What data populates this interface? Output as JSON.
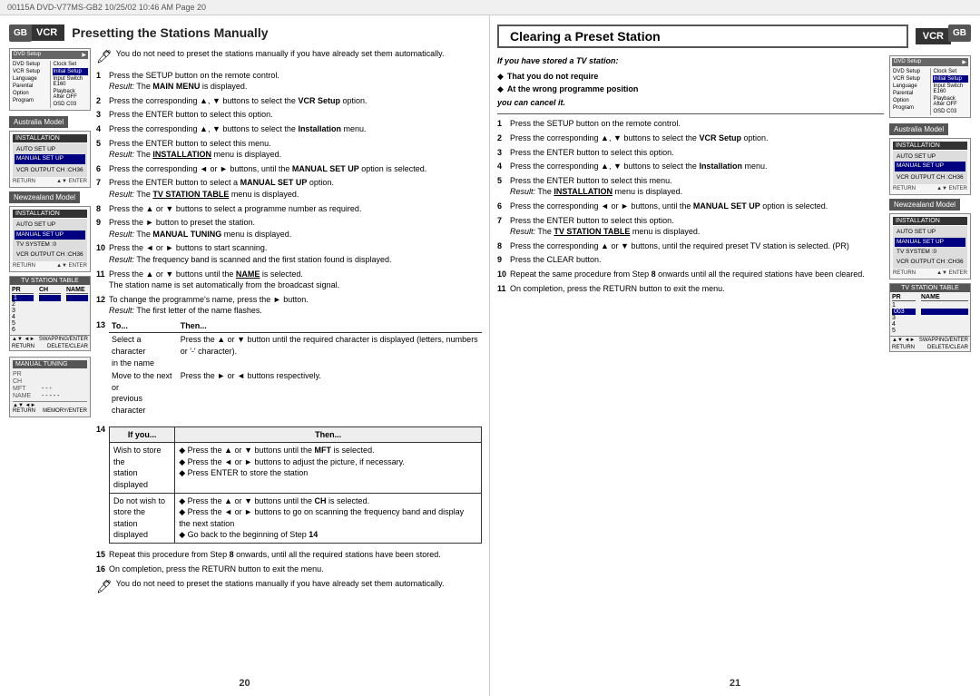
{
  "header": {
    "text": "00115A  DVD-V77MS-GB2   10/25/02  10:46 AM   Page 20"
  },
  "leftPage": {
    "vcr_badge": "VCR",
    "title": "Presetting the Stations Manually",
    "gb_badge": "GB",
    "note1": "You do not need to preset the stations manually if you have already set them automatically.",
    "steps": [
      {
        "num": "1",
        "text": "Press the SETUP button on the remote control.",
        "result": "The MAIN MENU is displayed.",
        "result_label": "Result:"
      },
      {
        "num": "2",
        "text": "Press the corresponding ▲, ▼ buttons to select the VCR Setup option.",
        "result": "",
        "result_label": ""
      },
      {
        "num": "3",
        "text": "Press the ENTER button to select this option.",
        "result": "",
        "result_label": ""
      },
      {
        "num": "4",
        "text": "Press the corresponding ▲, ▼ buttons to select the Installation menu.",
        "result": "",
        "result_label": ""
      },
      {
        "num": "5",
        "text": "Press the ENTER button to select this menu.",
        "result": "The INSTALLATION menu is displayed.",
        "result_label": "Result:"
      },
      {
        "num": "6",
        "text": "Press the corresponding ◄ or ► buttons, until the MANUAL SET UP option is selected.",
        "result": "",
        "result_label": ""
      },
      {
        "num": "7",
        "text": "Press the ENTER button to select a MANUAL SET UP option.",
        "result": "The TV STATION TABLE menu is displayed.",
        "result_label": "Result:"
      },
      {
        "num": "8",
        "text": "Press the ▲ or ▼ buttons to select a programme number as required.",
        "result": "",
        "result_label": ""
      },
      {
        "num": "9",
        "text": "Press the ► button to preset the station.",
        "result": "The MANUAL TUNING menu is displayed.",
        "result_label": "Result:"
      },
      {
        "num": "10",
        "text": "Press the ◄ or ► buttons to start scanning.",
        "result": "The frequency band is scanned and the first station found is displayed.",
        "result_label": "Result:"
      },
      {
        "num": "11",
        "text": "Press the ▲ or ▼ buttons until the NAME is selected.",
        "result": "The station name is set automatically from the broadcast signal.",
        "result_label": ""
      },
      {
        "num": "12",
        "text": "To change the programme's name, press the ► button.",
        "result": "The first letter of the name flashes.",
        "result_label": "Result:"
      },
      {
        "num": "13",
        "text": "To...",
        "then": "Then..."
      },
      {
        "num": "14",
        "text": "If you...",
        "then": "Then..."
      },
      {
        "num": "15",
        "text": "Repeat this procedure from Step 8 onwards, until all the required stations have been stored.",
        "result": "",
        "result_label": ""
      },
      {
        "num": "16",
        "text": "On completion, press the RETURN button to exit the menu.",
        "result": "",
        "result_label": ""
      }
    ],
    "step13_rows": [
      {
        "action": "Select a character in the name",
        "instruction": "Press the ▲ or ▼ button until the required character is displayed (letters, numbers or '-' character)."
      },
      {
        "action": "Move to the next or previous character",
        "instruction": "Press the ► or ◄ buttons respectively."
      }
    ],
    "step14_header": [
      "If you...",
      "Then..."
    ],
    "step14_rows": [
      {
        "condition": "Wish to store the station displayed",
        "instructions": [
          "Press the ▲ or ▼ buttons until the MFT is selected.",
          "Press the ◄ or ► buttons to adjust the picture, if necessary.",
          "Press ENTER to store the station"
        ]
      },
      {
        "condition": "Do not wish to store the station displayed",
        "instructions": [
          "Press the ▲ or ▼ buttons until the CH is selected.",
          "Press the ◄ or ► buttons to go on scanning the frequency band and display the next station",
          "Go back to the beginning of Step 14"
        ]
      }
    ],
    "note2": "You do not need to preset the stations manually if you have already set them automatically.",
    "australia_label": "Australia Model",
    "newzealand_label": "Newzealand Model",
    "page_number": "20",
    "screens": {
      "top_screen": {
        "menus": [
          "DVD Setup",
          "VCR Setup",
          "Language",
          "Parental",
          "Option",
          "Program"
        ],
        "right_menus": [
          "Clock Set",
          "Initial Setup",
          "Input Switch  E160",
          "Playback After  OFF",
          "OSD  C03"
        ]
      },
      "australia_installation": {
        "title": "INSTALLATION",
        "items": [
          "AUTO SET UP",
          "MANUAL SET UP"
        ],
        "highlighted": "MANUAL SET UP",
        "sub": "VCR OUTPUT CH  :CH36",
        "bottom": [
          "RETURN",
          "▲▼ ENTER"
        ]
      },
      "newzealand_installation": {
        "title": "INSTALLATION",
        "items": [
          "AUTO SET UP",
          "MANUAL SET UP"
        ],
        "highlighted": "MANUAL SET UP",
        "sub1": "TV SYSTEM  :0",
        "sub2": "VCR OUTPUT CH  :CH36",
        "bottom": [
          "RETURN",
          "▲▼ ENTER"
        ]
      },
      "tv_station_table": {
        "title": "TV STATION TABLE",
        "cols": [
          "PR",
          "CH",
          "NAME"
        ],
        "rows": [
          "1",
          "2",
          "3",
          "4",
          "5",
          "6"
        ],
        "highlighted_row": "1",
        "bottom": [
          "▲▼ ◄►  SWAPPING/ENTER",
          "RETURN  DELETE/CLEAR"
        ]
      },
      "manual_tuning": {
        "title": "MANUAL TUNING",
        "rows": [
          {
            "label": "PR",
            "value": ""
          },
          {
            "label": "CH",
            "value": ""
          },
          {
            "label": "MFT",
            "value": "- - -"
          },
          {
            "label": "NAME",
            "value": "- - - - -"
          }
        ],
        "bottom": [
          "▲▼ ◄►",
          "RETURN  MEMORY/ENTER"
        ]
      }
    }
  },
  "rightPage": {
    "title": "Clearing a Preset Station",
    "vcr_badge": "VCR",
    "gb_badge": "GB",
    "if_stored": "If you have stored a TV station:",
    "bullets": [
      "That you do not require",
      "At the wrong programme position"
    ],
    "cancel_note": "you can cancel it.",
    "steps": [
      {
        "num": "1",
        "text": "Press the SETUP button on the remote control.",
        "result": "",
        "result_label": ""
      },
      {
        "num": "2",
        "text": "Press the corresponding ▲, ▼ buttons to select the VCR Setup option.",
        "result": "",
        "result_label": ""
      },
      {
        "num": "3",
        "text": "Press the ENTER button to select this option.",
        "result": "",
        "result_label": ""
      },
      {
        "num": "4",
        "text": "Press the corresponding ▲, ▼ buttons to select the Installation menu.",
        "result": "",
        "result_label": ""
      },
      {
        "num": "5",
        "text": "Press the ENTER button to select this menu.",
        "result": "The INSTALLATION menu is displayed.",
        "result_label": "Result:"
      },
      {
        "num": "6",
        "text": "Press the corresponding ◄ or ► buttons, until the MANUAL SET UP option is selected.",
        "result": "",
        "result_label": ""
      },
      {
        "num": "7",
        "text": "Press the ENTER button to select this option.",
        "result": "The TV STATION TABLE menu is displayed.",
        "result_label": "Result:"
      },
      {
        "num": "8",
        "text": "Press the corresponding ▲ or ▼ buttons, until the required preset TV station is selected. (PR)",
        "result": "",
        "result_label": ""
      },
      {
        "num": "9",
        "text": "Press the CLEAR button.",
        "result": "",
        "result_label": ""
      },
      {
        "num": "10",
        "text": "Repeat the same procedure from Step 8 onwards until all the required stations have been cleared.",
        "result": "",
        "result_label": ""
      },
      {
        "num": "11",
        "text": "On completion, press the RETURN button to exit the menu.",
        "result": "",
        "result_label": ""
      }
    ],
    "australia_label": "Australia Model",
    "newzealand_label": "Newzealand Model",
    "page_number": "21",
    "screens": {
      "top_screen": {
        "menus": [
          "DVD Setup",
          "VCR Setup",
          "Language",
          "Parental",
          "Option",
          "Program"
        ],
        "right_menus": [
          "Clock Set",
          "Initial Setup",
          "Input Switch  E160",
          "Playback After  OFF",
          "OSD  C03"
        ]
      },
      "australia_installation": {
        "title": "INSTALLATION",
        "items": [
          "AUTO SET UP",
          "MANUAL SET UP"
        ],
        "highlighted": "MANUAL SET UP",
        "sub": "VCR OUTPUT CH  :CH36",
        "bottom": [
          "RETURN",
          "▲▼ ENTER"
        ]
      },
      "newzealand_installation": {
        "title": "INSTALLATION",
        "items": [
          "AUTO SET UP",
          "MANUAL SET UP"
        ],
        "highlighted": "MANUAL SET UP",
        "sub1": "TV SYSTEM  :0",
        "sub2": "VCR OUTPUT CH  :CH36",
        "bottom": [
          "RETURN",
          "▲▼ ENTER"
        ]
      },
      "tv_station_table": {
        "title": "TV STATION TABLE",
        "cols": [
          "PR",
          "NAME"
        ],
        "rows": [
          "1",
          "003",
          "3",
          "4",
          "5"
        ],
        "highlighted_row": "003",
        "bottom": [
          "▲▼ ◄►  SWAPPING/ENTER",
          "RETURN  DELETE/CLEAR"
        ]
      }
    }
  }
}
